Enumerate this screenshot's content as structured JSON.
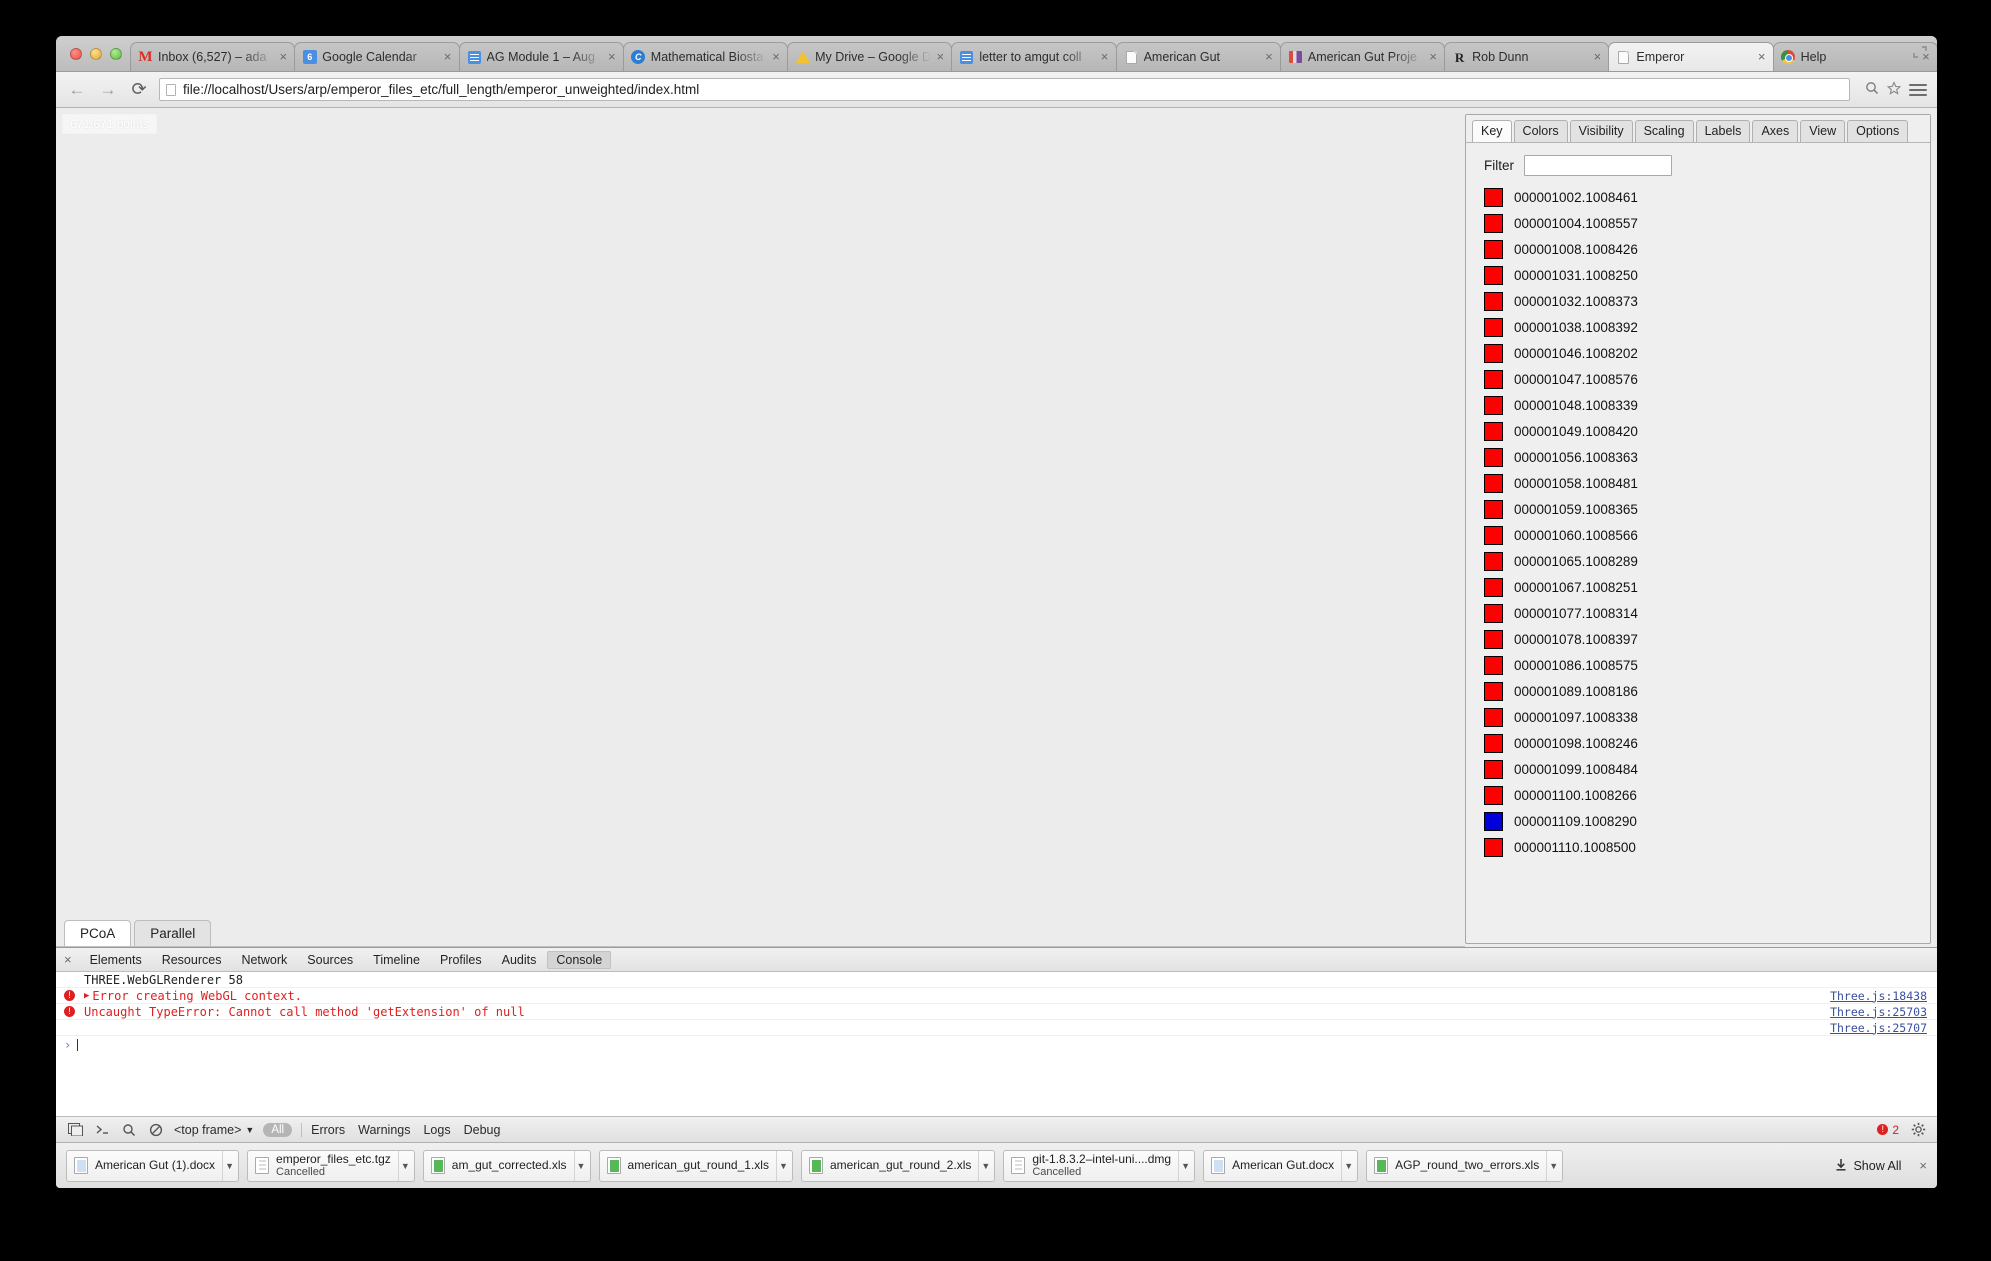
{
  "window": {
    "traffic_lights": [
      "close",
      "minimize",
      "zoom"
    ]
  },
  "tabs": [
    {
      "title": "Inbox (6,527) – ada",
      "favicon": "gmail-icon",
      "active": false
    },
    {
      "title": "Google Calendar",
      "favicon": "google-calendar-icon",
      "active": false
    },
    {
      "title": "AG Module 1 – Aug",
      "favicon": "google-docs-icon",
      "active": false
    },
    {
      "title": "Mathematical Biosta",
      "favicon": "blue-circle-icon",
      "active": false
    },
    {
      "title": "My Drive – Google D",
      "favicon": "google-drive-icon",
      "active": false
    },
    {
      "title": "letter to amgut coll",
      "favicon": "google-docs-icon",
      "active": false
    },
    {
      "title": "American Gut",
      "favicon": "page-icon",
      "active": false
    },
    {
      "title": "American Gut Proje",
      "favicon": "american-gut-icon",
      "active": false
    },
    {
      "title": "Rob Dunn",
      "favicon": "rob-dunn-icon",
      "active": false
    },
    {
      "title": "Emperor",
      "favicon": "page-icon",
      "active": true
    },
    {
      "title": "Help",
      "favicon": "chrome-icon",
      "active": false
    }
  ],
  "toolbar": {
    "back_label": "←",
    "forward_label": "→",
    "reload_label": "⟳",
    "url": "file://localhost/Users/arp/emperor_files_etc/full_length/emperor_unweighted/index.html",
    "zoom_icon": "magnifier-icon",
    "bookmark_icon": "star-icon",
    "menu_icon": "hamburger-menu-icon"
  },
  "viewport": {
    "points_badge": "671/671 points",
    "plot_tabs": [
      {
        "label": "PCoA",
        "active": true
      },
      {
        "label": "Parallel",
        "active": false
      }
    ]
  },
  "emperor": {
    "tabs": [
      {
        "label": "Key",
        "active": true
      },
      {
        "label": "Colors",
        "active": false
      },
      {
        "label": "Visibility",
        "active": false
      },
      {
        "label": "Scaling",
        "active": false
      },
      {
        "label": "Labels",
        "active": false
      },
      {
        "label": "Axes",
        "active": false
      },
      {
        "label": "View",
        "active": false
      },
      {
        "label": "Options",
        "active": false
      }
    ],
    "filter_label": "Filter",
    "filter_value": "",
    "filter_placeholder": "",
    "colors": {
      "red": "#FF0000",
      "blue": "#0000DD"
    },
    "key_items": [
      {
        "label": "000001002.1008461",
        "color": "#FF0000"
      },
      {
        "label": "000001004.1008557",
        "color": "#FF0000"
      },
      {
        "label": "000001008.1008426",
        "color": "#FF0000"
      },
      {
        "label": "000001031.1008250",
        "color": "#FF0000"
      },
      {
        "label": "000001032.1008373",
        "color": "#FF0000"
      },
      {
        "label": "000001038.1008392",
        "color": "#FF0000"
      },
      {
        "label": "000001046.1008202",
        "color": "#FF0000"
      },
      {
        "label": "000001047.1008576",
        "color": "#FF0000"
      },
      {
        "label": "000001048.1008339",
        "color": "#FF0000"
      },
      {
        "label": "000001049.1008420",
        "color": "#FF0000"
      },
      {
        "label": "000001056.1008363",
        "color": "#FF0000"
      },
      {
        "label": "000001058.1008481",
        "color": "#FF0000"
      },
      {
        "label": "000001059.1008365",
        "color": "#FF0000"
      },
      {
        "label": "000001060.1008566",
        "color": "#FF0000"
      },
      {
        "label": "000001065.1008289",
        "color": "#FF0000"
      },
      {
        "label": "000001067.1008251",
        "color": "#FF0000"
      },
      {
        "label": "000001077.1008314",
        "color": "#FF0000"
      },
      {
        "label": "000001078.1008397",
        "color": "#FF0000"
      },
      {
        "label": "000001086.1008575",
        "color": "#FF0000"
      },
      {
        "label": "000001089.1008186",
        "color": "#FF0000"
      },
      {
        "label": "000001097.1008338",
        "color": "#FF0000"
      },
      {
        "label": "000001098.1008246",
        "color": "#FF0000"
      },
      {
        "label": "000001099.1008484",
        "color": "#FF0000"
      },
      {
        "label": "000001100.1008266",
        "color": "#FF0000"
      },
      {
        "label": "000001109.1008290",
        "color": "#0000DD"
      },
      {
        "label": "000001110.1008500",
        "color": "#FF0000"
      }
    ]
  },
  "devtools": {
    "close_label": "×",
    "tabs": [
      {
        "label": "Elements",
        "active": false
      },
      {
        "label": "Resources",
        "active": false
      },
      {
        "label": "Network",
        "active": false
      },
      {
        "label": "Sources",
        "active": false
      },
      {
        "label": "Timeline",
        "active": false
      },
      {
        "label": "Profiles",
        "active": false
      },
      {
        "label": "Audits",
        "active": false
      },
      {
        "label": "Console",
        "active": true
      }
    ],
    "console_lines": [
      {
        "text": "THREE.WebGLRenderer 58",
        "level": "log",
        "source": "",
        "expandable": false
      },
      {
        "text": "Error creating WebGL context.",
        "level": "error",
        "source": "Three.js:18438",
        "expandable": true
      },
      {
        "text": "Uncaught TypeError: Cannot call method 'getExtension' of null",
        "level": "error",
        "source": "Three.js:25703",
        "expandable": false
      },
      {
        "text": "",
        "level": "source-only",
        "source": "Three.js:25707",
        "expandable": false
      }
    ],
    "prompt_caret": "›",
    "bottom_bar": {
      "dock_icon": "dock-to-side-icon",
      "console_drawer_icon": "show-drawer-icon",
      "search_icon": "search-icon",
      "clear_icon": "clear-console-icon",
      "frame_selector": "<top frame>",
      "frame_caret": "▼",
      "filter_all": "All",
      "filters": [
        "Errors",
        "Warnings",
        "Logs",
        "Debug"
      ],
      "error_count": "2",
      "settings_icon": "gear-icon"
    }
  },
  "downloads": {
    "items": [
      {
        "name": "American Gut (1).docx",
        "status": "",
        "icon": "docx-icon"
      },
      {
        "name": "emperor_files_etc.tgz",
        "status": "Cancelled",
        "icon": "archive-icon"
      },
      {
        "name": "am_gut_corrected.xls",
        "status": "",
        "icon": "xls-icon"
      },
      {
        "name": "american_gut_round_1.xls",
        "status": "",
        "icon": "xls-icon"
      },
      {
        "name": "american_gut_round_2.xls",
        "status": "",
        "icon": "xls-icon"
      },
      {
        "name": "git-1.8.3.2–intel-uni....dmg",
        "status": "Cancelled",
        "icon": "archive-icon"
      },
      {
        "name": "American Gut.docx",
        "status": "",
        "icon": "docx-icon"
      },
      {
        "name": "AGP_round_two_errors.xls",
        "status": "",
        "icon": "xls-icon"
      }
    ],
    "show_all_label": "Show All",
    "show_all_icon": "download-arrow-icon",
    "close_label": "×"
  }
}
